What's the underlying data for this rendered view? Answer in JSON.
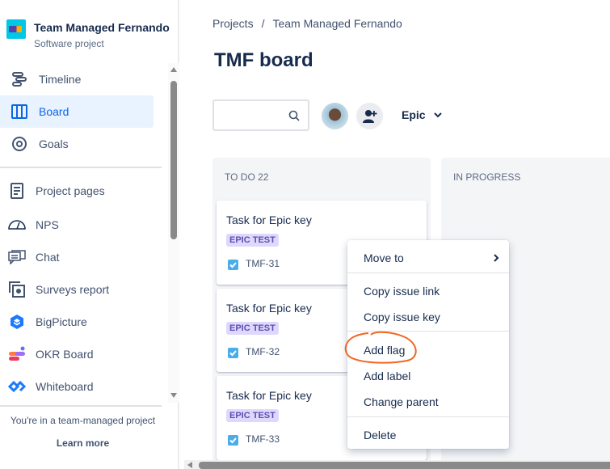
{
  "sidebar": {
    "project_title": "Team Managed Fernando",
    "project_type": "Software project",
    "items": [
      {
        "label": "Timeline",
        "icon": "timeline-icon"
      },
      {
        "label": "Board",
        "icon": "board-icon",
        "active": true
      },
      {
        "label": "Goals",
        "icon": "goals-icon"
      },
      {
        "label": "Project pages",
        "icon": "page-icon"
      },
      {
        "label": "NPS",
        "icon": "gauge-icon"
      },
      {
        "label": "Chat",
        "icon": "chat-icon"
      },
      {
        "label": "Surveys report",
        "icon": "survey-icon"
      },
      {
        "label": "BigPicture",
        "icon": "bigpicture-icon"
      },
      {
        "label": "OKR Board",
        "icon": "okr-icon"
      },
      {
        "label": "Whiteboard",
        "icon": "whiteboard-icon"
      }
    ],
    "footer_text": "You're in a team-managed project",
    "footer_link": "Learn more"
  },
  "header": {
    "breadcrumb": [
      "Projects",
      "Team Managed Fernando"
    ],
    "breadcrumb_sep": "/",
    "title": "TMF board"
  },
  "toolbar": {
    "search_value": "",
    "epic_label": "Epic"
  },
  "columns": [
    {
      "title": "TO DO 22"
    },
    {
      "title": "IN PROGRESS"
    }
  ],
  "cards": [
    {
      "title": "Task for Epic key",
      "label": "EPIC TEST",
      "key": "TMF-31"
    },
    {
      "title": "Task for Epic key",
      "label": "EPIC TEST",
      "key": "TMF-32"
    },
    {
      "title": "Task for Epic key",
      "label": "EPIC TEST",
      "key": "TMF-33"
    }
  ],
  "context_menu": {
    "move_to": "Move to",
    "copy_link": "Copy issue link",
    "copy_key": "Copy issue key",
    "add_flag": "Add flag",
    "add_label": "Add label",
    "change_parent": "Change parent",
    "delete": "Delete"
  },
  "colors": {
    "accent": "#0c66e4",
    "annotation": "#f26522",
    "epic_label": "#5e4db2"
  }
}
